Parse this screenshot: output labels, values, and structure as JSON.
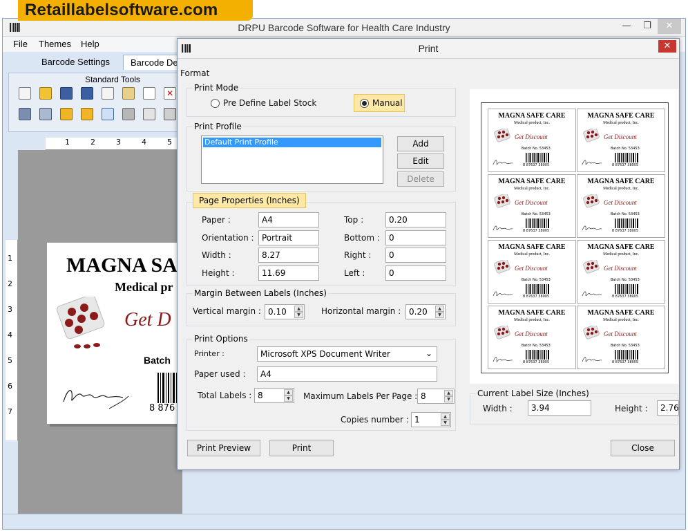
{
  "banner": {
    "text": "Retaillabelsoftware.com"
  },
  "main_window": {
    "title": "DRPU Barcode Software for Health Care Industry",
    "controls": {
      "minimize": "—",
      "restore": "❐",
      "close": "✕"
    },
    "menu": {
      "file": "File",
      "themes": "Themes",
      "help": "Help"
    },
    "tabs": {
      "barcode_settings": "Barcode Settings",
      "barcode_designer": "Barcode De"
    },
    "toolbar_title": "Standard Tools",
    "ruler_top": [
      "1",
      "2",
      "3",
      "4",
      "5"
    ],
    "ruler_left": [
      "1",
      "2",
      "3",
      "4",
      "5",
      "6",
      "7"
    ]
  },
  "canvas_label": {
    "company": "MAGNA SA",
    "product": "Medical pr",
    "discount": "Get D",
    "batch": "Batch",
    "barcode_num": "8 876"
  },
  "print_dialog": {
    "title": "Print",
    "close": "✕",
    "format_label": "Format",
    "print_mode": {
      "title": "Print Mode",
      "option_predefine": "Pre Define Label Stock",
      "option_manual": "Manual",
      "selected": "Manual"
    },
    "print_profile": {
      "title": "Print Profile",
      "items": [
        "Default Print Profile"
      ],
      "add": "Add",
      "edit": "Edit",
      "delete": "Delete"
    },
    "page_properties": {
      "title": "Page Properties (Inches)",
      "paper_label": "Paper :",
      "paper": "A4",
      "orientation_label": "Orientation :",
      "orientation": "Portrait",
      "width_label": "Width :",
      "width": "8.27",
      "height_label": "Height :",
      "height": "11.69",
      "top_label": "Top :",
      "top": "0.20",
      "bottom_label": "Bottom :",
      "bottom": "0",
      "right_label": "Right :",
      "right": "0",
      "left_label": "Left :",
      "left": "0"
    },
    "margin_between": {
      "title": "Margin Between Labels (Inches)",
      "vertical_label": "Vertical margin :",
      "vertical": "0.10",
      "horizontal_label": "Horizontal margin :",
      "horizontal": "0.20"
    },
    "print_options": {
      "title": "Print Options",
      "printer_label": "Printer :",
      "printer": "Microsoft XPS Document Writer",
      "paper_used_label": "Paper used :",
      "paper_used": "A4",
      "total_labels_label": "Total Labels :",
      "total_labels": "8",
      "max_per_page_label": "Maximum Labels Per Page :",
      "max_per_page": "8",
      "copies_label": "Copies number :",
      "copies": "1"
    },
    "current_size": {
      "title": "Current Label Size (Inches)",
      "width_label": "Width :",
      "width": "3.94",
      "height_label": "Height :",
      "height": "2.76"
    },
    "buttons": {
      "print_preview": "Print Preview",
      "print": "Print",
      "close": "Close"
    }
  },
  "preview_label": {
    "company": "MAGNA SAFE CARE",
    "product": "Medical product, Inc.",
    "discount": "Get Discount",
    "batch": "Batch No. 53453",
    "barcode_num": "8 87637 38005"
  },
  "colors": {
    "banner": "#f3b000",
    "highlight": "#fde8a6",
    "selection": "#3399ff",
    "close_button": "#c7372f",
    "discount_text": "#8b1a1a"
  }
}
